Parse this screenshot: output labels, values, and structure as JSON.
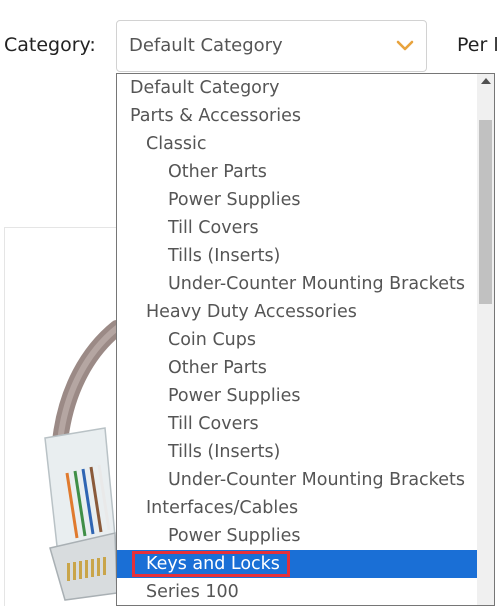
{
  "filter": {
    "category_label": "Category:",
    "selected_value": "Default Category",
    "per_label": "Per l"
  },
  "dropdown": {
    "options": [
      {
        "label": "Default Category",
        "level": 0
      },
      {
        "label": "Parts & Accessories",
        "level": 0
      },
      {
        "label": "Classic",
        "level": 1
      },
      {
        "label": "Other Parts",
        "level": 2
      },
      {
        "label": "Power Supplies",
        "level": 2
      },
      {
        "label": "Till Covers",
        "level": 2
      },
      {
        "label": "Tills (Inserts)",
        "level": 2
      },
      {
        "label": "Under-Counter Mounting Brackets",
        "level": 2
      },
      {
        "label": "Heavy Duty Accessories",
        "level": 1
      },
      {
        "label": "Coin Cups",
        "level": 2
      },
      {
        "label": "Other Parts",
        "level": 2
      },
      {
        "label": "Power Supplies",
        "level": 2
      },
      {
        "label": "Till Covers",
        "level": 2
      },
      {
        "label": "Tills (Inserts)",
        "level": 2
      },
      {
        "label": "Under-Counter Mounting Brackets",
        "level": 2
      },
      {
        "label": "Interfaces/Cables",
        "level": 1
      },
      {
        "label": "Power Supplies",
        "level": 2
      },
      {
        "label": "Keys and Locks",
        "level": 1,
        "selected": true,
        "highlighted": true
      },
      {
        "label": "Series 100",
        "level": 1
      }
    ]
  },
  "colors": {
    "selection": "#1a6fd6",
    "highlight_box": "#e6303a",
    "chevron": "#e8a33d"
  },
  "icons": {
    "chevron": "chevron-down-icon"
  }
}
